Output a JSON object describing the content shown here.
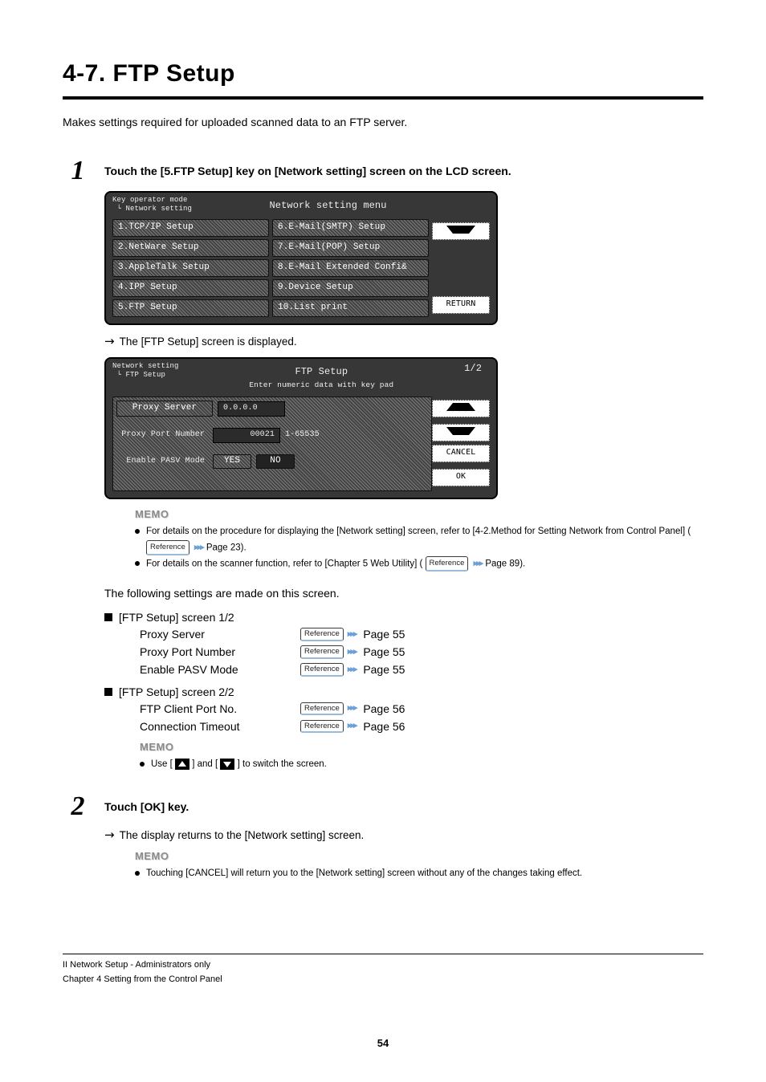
{
  "title": "4-7. FTP Setup",
  "intro": "Makes settings required for uploaded scanned data to an FTP server.",
  "steps": {
    "s1": {
      "num": "1",
      "instr": "Touch the [5.FTP Setup] key on [Network setting] screen on the LCD screen."
    },
    "s2": {
      "num": "2",
      "instr": "Touch [OK] key."
    }
  },
  "lcd1": {
    "breadcrumb": "Key operator mode\n └ Network setting",
    "title": "Network setting menu",
    "left": [
      "1.TCP/IP Setup",
      "2.NetWare Setup",
      "3.AppleTalk Setup",
      "4.IPP Setup",
      "5.FTP Setup"
    ],
    "right": [
      "6.E-Mail(SMTP) Setup",
      "7.E-Mail(POP) Setup",
      "8.E-Mail Extended Confi&",
      "9.Device Setup",
      "10.List print"
    ],
    "return": "RETURN"
  },
  "arrow1": "The [FTP Setup] screen is displayed.",
  "lcd2": {
    "breadcrumb": "Network setting\n └ FTP Setup",
    "title": "FTP Setup",
    "sub": "Enter numeric data with key pad",
    "pagefrac": "1/2",
    "rows": {
      "proxy_server_lbl": "Proxy Server",
      "proxy_server_val": "0.0.0.0",
      "proxy_port_lbl": "Proxy Port Number",
      "proxy_port_val": "00021",
      "proxy_port_range": "1-65535",
      "pasv_lbl": "Enable PASV Mode",
      "pasv_yes": "YES",
      "pasv_no": "NO"
    },
    "side": {
      "cancel": "CANCEL",
      "ok": "OK"
    }
  },
  "memo1": {
    "hd": "MEMO",
    "li1_a": "For details on the procedure for displaying the [Network setting] screen, refer to [4-2.Method for Setting Network from Control Panel] (",
    "li1_badge": "Reference",
    "li1_b": " Page 23).",
    "li2_a": "For details on the scanner function, refer to [Chapter 5 Web Utility] (",
    "li2_badge": "Reference",
    "li2_b": " Page 89)."
  },
  "settings_intro": "The following settings are made on this screen.",
  "sections": {
    "a_lbl": "[FTP Setup] screen 1/2",
    "a_rows": [
      {
        "name": "Proxy Server",
        "page": "Page 55"
      },
      {
        "name": "Proxy Port Number",
        "page": "Page 55"
      },
      {
        "name": "Enable PASV Mode",
        "page": "Page 55"
      }
    ],
    "b_lbl": "[FTP Setup] screen 2/2",
    "b_rows": [
      {
        "name": "FTP Client Port No.",
        "page": "Page 56"
      },
      {
        "name": "Connection Timeout",
        "page": "Page 56"
      }
    ]
  },
  "memo2": {
    "hd": "MEMO",
    "li": "Use [      ] and [      ] to switch the screen.",
    "li_pre": "Use [",
    "li_mid": "] and [",
    "li_post": "] to switch the screen."
  },
  "step2_result": "The display returns to the [Network setting] screen.",
  "memo3": {
    "hd": "MEMO",
    "li": "Touching [CANCEL] will return you to the [Network setting] screen without any of the changes taking effect."
  },
  "footer": {
    "l1": "II Network Setup - Administrators only",
    "l2": "Chapter 4 Setting from the Control Panel",
    "page": "54"
  },
  "ref_badge": "Reference"
}
